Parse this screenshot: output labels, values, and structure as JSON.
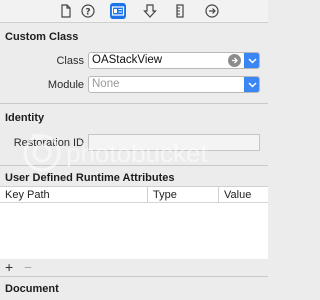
{
  "toolbar": {
    "tabs": [
      {
        "icon": "file-inspector-icon",
        "active": false
      },
      {
        "icon": "quick-help-icon",
        "active": false
      },
      {
        "icon": "identity-inspector-icon",
        "active": true
      },
      {
        "icon": "attributes-inspector-icon",
        "active": false
      },
      {
        "icon": "size-inspector-icon",
        "active": false
      },
      {
        "icon": "connections-inspector-icon",
        "active": false
      }
    ],
    "accent": "#1a73e8"
  },
  "custom_class": {
    "title": "Custom Class",
    "class_label": "Class",
    "class_value": "OAStackView",
    "module_label": "Module",
    "module_placeholder": "None"
  },
  "identity": {
    "title": "Identity",
    "restoration_label": "Restoration ID",
    "restoration_value": ""
  },
  "runtime_attributes": {
    "title": "User Defined Runtime Attributes",
    "columns": [
      "Key Path",
      "Type",
      "Value"
    ],
    "rows": [],
    "add_label": "+",
    "remove_label": "−"
  },
  "document": {
    "title": "Document"
  },
  "watermark": {
    "text": "photobucket"
  }
}
